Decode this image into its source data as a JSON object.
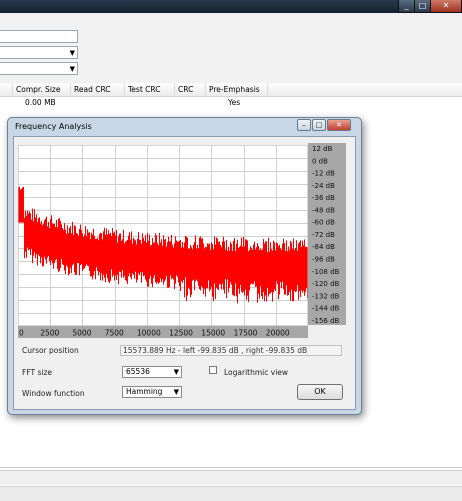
{
  "window": {
    "minimize_glyph": "_",
    "maximize_glyph": "□",
    "close_glyph": "✕"
  },
  "table": {
    "columns": [
      "Compr. Size",
      "Read CRC",
      "Test CRC",
      "CRC",
      "Pre-Emphasis"
    ],
    "rows": [
      {
        "compr_size": "0.00 MB",
        "pre_emphasis": "Yes"
      }
    ]
  },
  "dialog": {
    "title": "Frequency Analysis",
    "minimize_glyph": "–",
    "maximize_glyph": "□",
    "close_glyph": "✕",
    "db_labels": [
      "12 dB",
      "0 dB",
      "-12 dB",
      "-24 dB",
      "-36 dB",
      "-48 dB",
      "-60 dB",
      "-72 dB",
      "-84 dB",
      "-96 dB",
      "-108 dB",
      "-120 dB",
      "-132 dB",
      "-144 dB",
      "-156 dB"
    ],
    "freq_labels": [
      "0",
      "2500",
      "5000",
      "7500",
      "10000",
      "12500",
      "15000",
      "17500",
      "20000"
    ],
    "cursor_label": "Cursor position",
    "cursor_value": "15573.889 Hz - left -99.835 dB , right -99.835 dB",
    "fft_label": "FFT size",
    "fft_value": "65536",
    "window_label": "Window function",
    "window_value": "Hamming",
    "log_label": "Logarithmic view",
    "log_checked": false,
    "ok_label": "OK",
    "spectrum_color": "#ff0000",
    "grid_color": "#d0d0d0",
    "panel_color": "#a7a7a7"
  }
}
